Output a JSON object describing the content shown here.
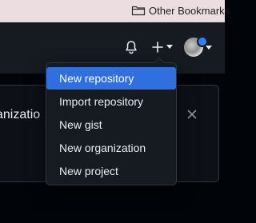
{
  "bookmarks_bar": {
    "folder_label": "Other Bookmarks",
    "folder_icon": "folder-icon"
  },
  "header": {
    "icons": [
      "bell-icon",
      "plus-icon",
      "caret-down-icon",
      "avatar"
    ],
    "notification_dot_color": "#2f81f7"
  },
  "banner": {
    "text": "anizatio",
    "close_icon": "close-icon"
  },
  "create_menu": {
    "items": [
      {
        "label": "New repository",
        "highlighted": true
      },
      {
        "label": "Import repository",
        "highlighted": false
      },
      {
        "label": "New gist",
        "highlighted": false
      },
      {
        "label": "New organization",
        "highlighted": false
      },
      {
        "label": "New project",
        "highlighted": false
      }
    ],
    "highlight_color": "#2f6fe0"
  }
}
